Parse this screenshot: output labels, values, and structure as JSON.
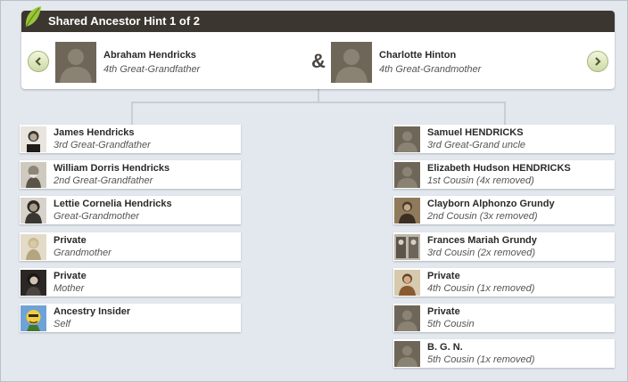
{
  "header": {
    "title": "Shared Ancestor Hint 1 of 2"
  },
  "couple": {
    "left": {
      "name": "Abraham Hendricks",
      "relation": "4th Great-Grandfather"
    },
    "right": {
      "name": "Charlotte Hinton",
      "relation": "4th Great-Grandmother"
    },
    "separator": "&"
  },
  "left_line": [
    {
      "name": "James Hendricks",
      "relation": "3rd Great-Grandfather"
    },
    {
      "name": "William Dorris Hendricks",
      "relation": "2nd Great-Grandfather"
    },
    {
      "name": "Lettie Cornelia Hendricks",
      "relation": "Great-Grandmother"
    },
    {
      "name": "Private",
      "relation": "Grandmother"
    },
    {
      "name": "Private",
      "relation": "Mother"
    },
    {
      "name": "Ancestry Insider",
      "relation": "Self"
    }
  ],
  "right_line": [
    {
      "name": "Samuel HENDRICKS",
      "relation": "3rd Great-Grand uncle"
    },
    {
      "name": "Elizabeth Hudson HENDRICKS",
      "relation": "1st Cousin (4x removed)"
    },
    {
      "name": "Clayborn Alphonzo Grundy",
      "relation": "2nd Cousin (3x removed)"
    },
    {
      "name": "Frances Mariah Grundy",
      "relation": "3rd Cousin (2x removed)"
    },
    {
      "name": "Private",
      "relation": "4th Cousin (1x removed)"
    },
    {
      "name": "Private",
      "relation": "5th Cousin"
    },
    {
      "name": "B. G. N.",
      "relation": "5th Cousin (1x removed)"
    }
  ],
  "colors": {
    "header_bg": "#3b3630",
    "placeholder": "#6e6658",
    "nav_button": "#cfd9a6",
    "connector": "#c8ced5"
  },
  "icons": {
    "leaf": "leaf-icon",
    "prev": "chevron-left-icon",
    "next": "chevron-right-icon"
  }
}
